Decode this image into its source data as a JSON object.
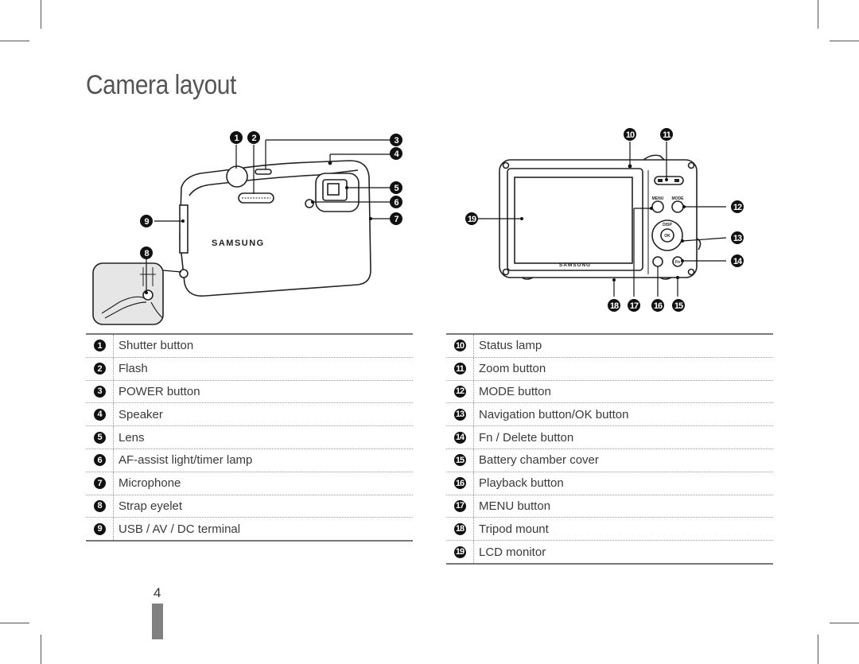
{
  "page": {
    "title": "Camera layout",
    "page_number": "4"
  },
  "front_view": {
    "brand_logo": "SAMSUNG",
    "callouts": [
      "1",
      "2",
      "3",
      "4",
      "5",
      "6",
      "7",
      "8",
      "9"
    ]
  },
  "back_view": {
    "brand_logo": "SAMSUNG",
    "button_labels": {
      "menu": "MENU",
      "mode": "MODE",
      "disp": "DISP",
      "ok": "OK",
      "fn": "Fn"
    },
    "callouts": [
      "10",
      "11",
      "12",
      "13",
      "14",
      "15",
      "16",
      "17",
      "18",
      "19"
    ]
  },
  "front_table": [
    {
      "num": "1",
      "label": "Shutter button"
    },
    {
      "num": "2",
      "label": "Flash"
    },
    {
      "num": "3",
      "label": "POWER button"
    },
    {
      "num": "4",
      "label": "Speaker"
    },
    {
      "num": "5",
      "label": "Lens"
    },
    {
      "num": "6",
      "label": "AF-assist light/timer lamp"
    },
    {
      "num": "7",
      "label": "Microphone"
    },
    {
      "num": "8",
      "label": "Strap eyelet"
    },
    {
      "num": "9",
      "label": "USB / AV / DC terminal"
    }
  ],
  "back_table": [
    {
      "num": "10",
      "label": "Status lamp"
    },
    {
      "num": "11",
      "label": "Zoom button"
    },
    {
      "num": "12",
      "label": "MODE button"
    },
    {
      "num": "13",
      "label": "Navigation button/OK button"
    },
    {
      "num": "14",
      "label": "Fn / Delete button"
    },
    {
      "num": "15",
      "label": "Battery chamber cover"
    },
    {
      "num": "16",
      "label": "Playback button"
    },
    {
      "num": "17",
      "label": "MENU button"
    },
    {
      "num": "18",
      "label": "Tripod mount"
    },
    {
      "num": "19",
      "label": "LCD monitor"
    }
  ]
}
